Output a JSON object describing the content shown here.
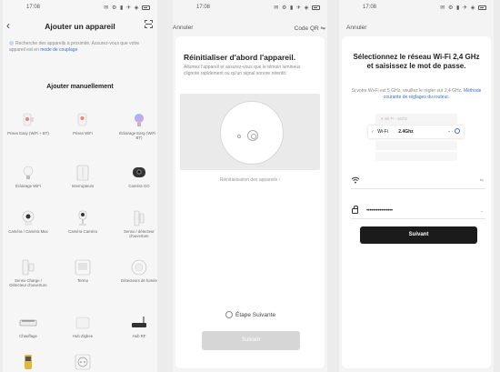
{
  "status_bar": {
    "time": "17:08",
    "icons": "✉ ⚙ ▮ ✈ ◈"
  },
  "screen1": {
    "title": "Ajouter un appareil",
    "nearby_text": "Recherche des appareils à proximité. Assurez-vous que votre appareil est en",
    "nearby_link": "mode de couplage",
    "manual_title": "Ajouter manuellement",
    "devices": [
      {
        "label": "Prises Easy (WiFi + BT)",
        "icon": "plug-icon"
      },
      {
        "label": "Prises WiFi",
        "icon": "plug-icon"
      },
      {
        "label": "Éclairage Easy (WiFi + BT)",
        "icon": "bulb-icon"
      },
      {
        "label": "Éclairage WiFi",
        "icon": "bulb-icon"
      },
      {
        "label": "Interrupteurs",
        "icon": "switch-icon"
      },
      {
        "label": "Caméra GO",
        "icon": "camera-icon"
      },
      {
        "label": "Caméra / Caméra Max",
        "icon": "camera-icon"
      },
      {
        "label": "Caméra Caméra",
        "icon": "camera-icon"
      },
      {
        "label": "Senso / détecteur d'ouverture",
        "icon": "door-sensor-icon"
      },
      {
        "label": "Senso Charge / Détecteur d'ouverture",
        "icon": "sensor-icon"
      },
      {
        "label": "Termo",
        "icon": "thermometer-icon"
      },
      {
        "label": "Détecteurs de fumée",
        "icon": "smoke-detector-icon"
      },
      {
        "label": "Chauffage",
        "icon": "heater-icon"
      },
      {
        "label": "Hub Zigbee",
        "icon": "hub-icon"
      },
      {
        "label": "Hub RF",
        "icon": "hub-icon"
      },
      {
        "label": "",
        "icon": "valve-icon"
      },
      {
        "label": "",
        "icon": "socket-icon"
      }
    ]
  },
  "screen2": {
    "cancel": "Annuler",
    "qr": "Code QR",
    "title": "Réinitialiser d'abord l'appareil.",
    "description": "Allumez l'appareil et assurez-vous que le témoin lumineux clignote rapidement ou qu'un signal sonore retentit.",
    "reset_link": "Réinitialisation des appareils",
    "next_step": "Étape Suivante",
    "next_button": "Suivant"
  },
  "screen3": {
    "cancel": "Annuler",
    "title": "Sélectionnez le réseau Wi-Fi 2,4 GHz et saisissez le mot de passe.",
    "note": "Si votre Wi-Fi est 5 GHz, veuillez le régler sur 2,4 GHz.",
    "note_link": "Méthode courante de réglages du routeur.",
    "router_5g": "Wi-Fi · 5Ghz",
    "router_24_name": "Wi-Fi",
    "router_24_band": "2.4Ghz",
    "wifi_value": "",
    "password_value": "••••••••••••••••",
    "next_button": "Suivant"
  }
}
